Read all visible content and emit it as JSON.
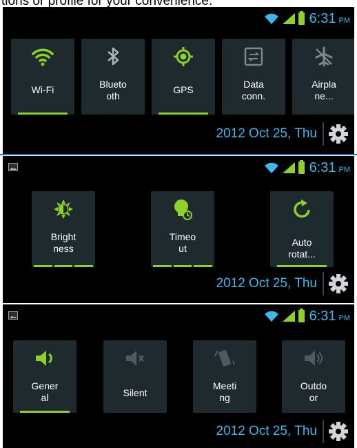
{
  "caption": "tions or profile for your convenience.",
  "status": {
    "time": "6:31",
    "ampm": "PM"
  },
  "date": "2012 Oct 25, Thu",
  "panels": [
    {
      "toggles": [
        {
          "label": "Wi-Fi",
          "icon": "wifi-icon",
          "state": "on"
        },
        {
          "label": "Blueto\noth",
          "icon": "bluetooth-icon",
          "state": "off"
        },
        {
          "label": "GPS",
          "icon": "gps-icon",
          "state": "on"
        },
        {
          "label": "Data\nconn.",
          "icon": "data-connection-icon",
          "state": "off"
        },
        {
          "label": "Airpla\nne...",
          "icon": "airplane-icon",
          "state": "off"
        }
      ]
    },
    {
      "toggles": [
        {
          "label": "Bright\nness",
          "icon": "brightness-icon",
          "state": "segmented"
        },
        {
          "label": "Timeo\nut",
          "icon": "timeout-icon",
          "state": "segmented"
        },
        {
          "label": "Auto\nrotat...",
          "icon": "auto-rotate-icon",
          "state": "on"
        }
      ]
    },
    {
      "toggles": [
        {
          "label": "Gener\nal",
          "icon": "sound-general-icon",
          "state": "on"
        },
        {
          "label": "Silent",
          "icon": "silent-icon",
          "state": "off"
        },
        {
          "label": "Meeti\nng",
          "icon": "vibrate-icon",
          "state": "off"
        },
        {
          "label": "Outdo\nor",
          "icon": "outdoor-icon",
          "state": "off"
        }
      ]
    }
  ],
  "colors": {
    "accent_green": "#8fd12b",
    "accent_blue": "#42b6ea",
    "tile_bg": "#1f2a2e",
    "disabled_icon": "#5d6a6f"
  }
}
